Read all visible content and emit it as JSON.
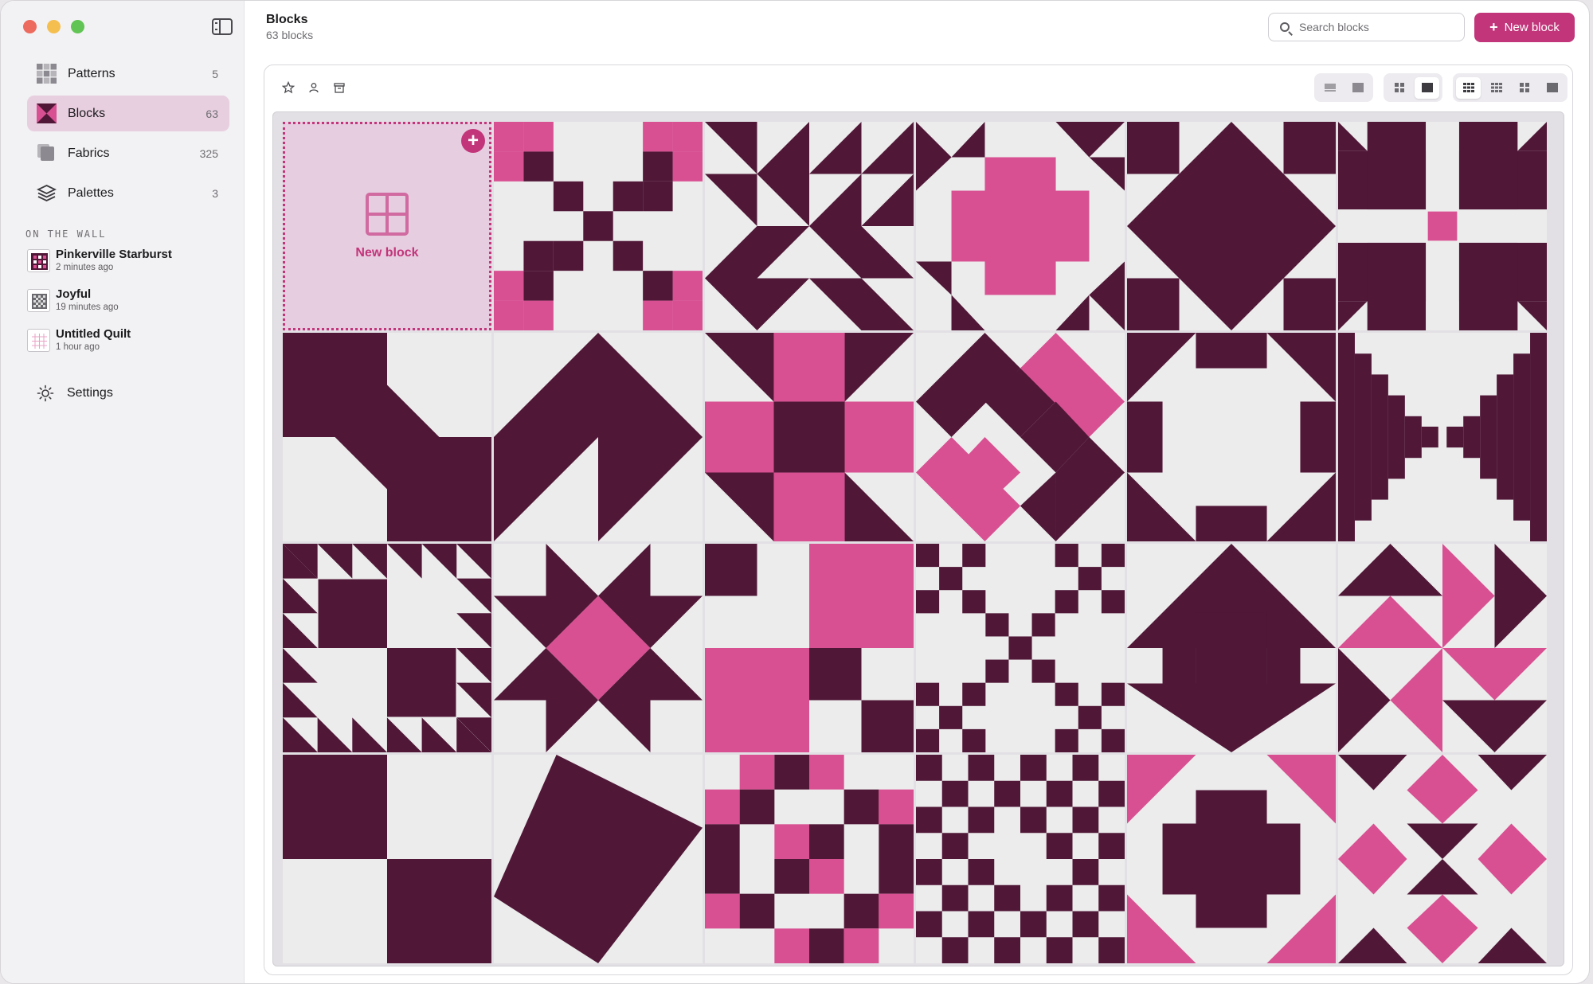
{
  "colors": {
    "dark": "#501737",
    "pink": "#d85092",
    "bg": "#ececec",
    "accent": "#c2357a"
  },
  "window": {
    "buttons": [
      "close",
      "minimize",
      "zoom"
    ]
  },
  "sidebar": {
    "toggle_icon": "sidebar-toggle-icon",
    "items": [
      {
        "label": "Patterns",
        "count": "5",
        "icon": "patterns-icon"
      },
      {
        "label": "Blocks",
        "count": "63",
        "icon": "blocks-icon",
        "active": true
      },
      {
        "label": "Fabrics",
        "count": "325",
        "icon": "fabrics-icon"
      },
      {
        "label": "Palettes",
        "count": "3",
        "icon": "palettes-icon"
      }
    ],
    "section_label": "ON THE WALL",
    "wall": [
      {
        "name": "Pinkerville Starburst",
        "time": "2 minutes ago"
      },
      {
        "name": "Joyful",
        "time": "19 minutes ago"
      },
      {
        "name": "Untitled Quilt",
        "time": "1 hour ago"
      }
    ],
    "settings_label": "Settings"
  },
  "header": {
    "title": "Blocks",
    "subtitle": "63 blocks",
    "search_placeholder": "Search blocks",
    "new_button": "New block"
  },
  "toolbar": {
    "filters": [
      "star-icon",
      "person-icon",
      "archive-icon"
    ],
    "view_segments": [
      "list-size-toggle",
      "grid-layout-toggle",
      "column-count-toggle"
    ]
  },
  "grid": {
    "new_tile_label": "New block",
    "blocks": [
      "new",
      "pinwheel-nine",
      "lemoyne-star",
      "pink-cross",
      "diamond-square",
      "bear-paw",
      "bent-corner",
      "hourglass",
      "cross-star",
      "pink-chain",
      "octagon",
      "log-steps",
      "sawtooth-star",
      "pink-diamond-star",
      "four-patch",
      "nine-patch-chain",
      "arrow-cross",
      "pinwheel-triangles",
      "big-four-patch",
      "swallow",
      "pink-checker",
      "woven-star",
      "pink-corner-cross",
      "pink-diamond-ring"
    ]
  }
}
